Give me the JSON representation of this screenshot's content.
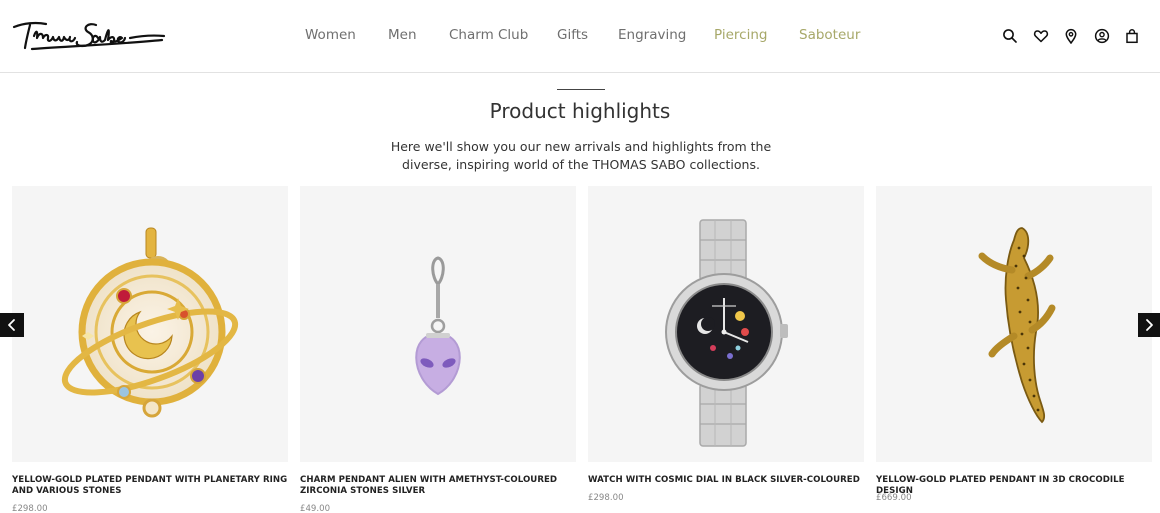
{
  "brand": {
    "name": "Thomas Sabo"
  },
  "nav": {
    "items": [
      {
        "label": "Women"
      },
      {
        "label": "Men"
      },
      {
        "label": "Charm Club"
      },
      {
        "label": "Gifts"
      },
      {
        "label": "Engraving"
      },
      {
        "label": "Piercing"
      },
      {
        "label": "Saboteur"
      }
    ],
    "accent_color": "#a7a869",
    "text_color": "#6f6f6f"
  },
  "header_icons": [
    "search-icon",
    "heart-icon",
    "location-pin-icon",
    "account-icon",
    "shopping-bag-icon"
  ],
  "highlights": {
    "title": "Product highlights",
    "intro_line1": "Here we'll show you our new arrivals and highlights from the",
    "intro_line2": "diverse, inspiring world of the THOMAS SABO collections."
  },
  "products": [
    {
      "title": "YELLOW-GOLD PLATED PENDANT WITH PLANETARY RING AND VARIOUS STONES",
      "price": "£298.00"
    },
    {
      "title": "CHARM PENDANT ALIEN WITH AMETHYST-COLOURED ZIRCONIA STONES SILVER",
      "price": "£49.00"
    },
    {
      "title": "WATCH WITH COSMIC DIAL IN BLACK SILVER-COLOURED",
      "price": "£298.00"
    },
    {
      "title": "YELLOW-GOLD PLATED PENDANT IN 3D CROCODILE DESIGN",
      "price": "£669.00"
    }
  ],
  "carousel": {
    "prev_icon": "chevron-left-icon",
    "next_icon": "chevron-right-icon"
  }
}
